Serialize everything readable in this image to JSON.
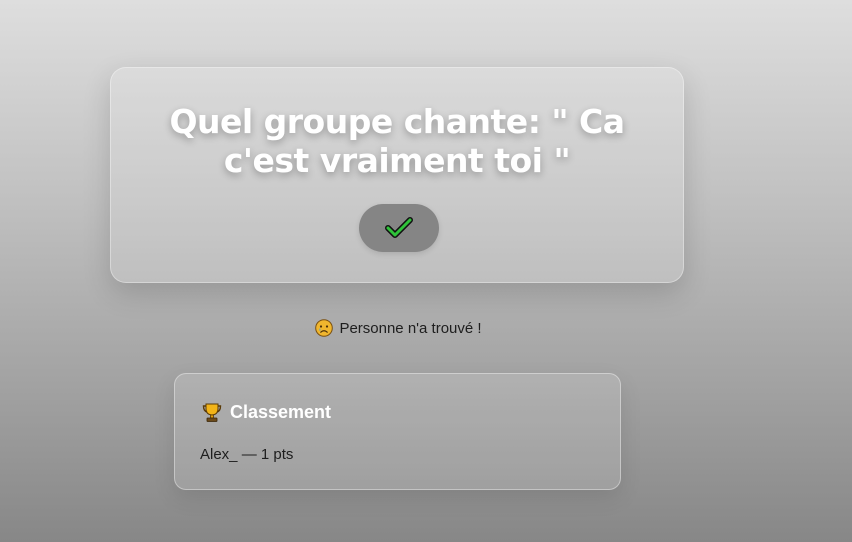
{
  "question": {
    "text": "Quel groupe chante: \" Ca c'est vraiment toi \"",
    "answer_button_icon": "checkmark-icon"
  },
  "result": {
    "icon": "sad-face-icon",
    "text": "Personne n'a trouvé !"
  },
  "leaderboard": {
    "icon": "trophy-icon",
    "title": "Classement",
    "entries": [
      {
        "player": "Alex_",
        "separator": "—",
        "points": "1 pts"
      }
    ]
  }
}
